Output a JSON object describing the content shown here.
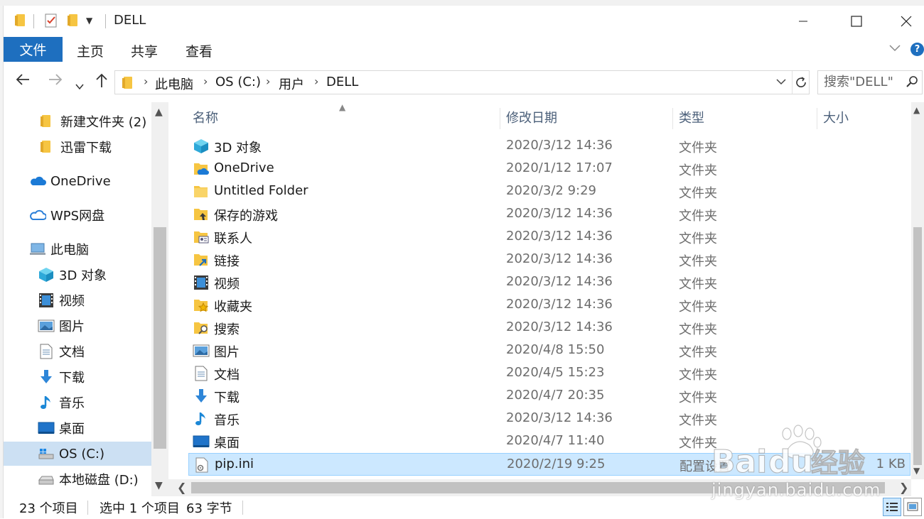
{
  "window": {
    "title": "DELL"
  },
  "ribbon": {
    "file_tab": "文件",
    "tabs": [
      "主页",
      "共享",
      "查看"
    ]
  },
  "address": {
    "crumbs": [
      "此电脑",
      "OS (C:)",
      "用户",
      "DELL"
    ]
  },
  "search": {
    "placeholder": "搜索\"DELL\""
  },
  "navpane": {
    "items": [
      {
        "label": "新建文件夹 (2)",
        "icon": "folder-icon"
      },
      {
        "label": "迅雷下载",
        "icon": "folder-icon"
      },
      {
        "label": "OneDrive",
        "icon": "cloud-icon"
      },
      {
        "label": "WPS网盘",
        "icon": "cloud-outline-icon"
      },
      {
        "label": "此电脑",
        "icon": "computer-icon"
      },
      {
        "label": "3D 对象",
        "icon": "cube-icon"
      },
      {
        "label": "视频",
        "icon": "video-icon"
      },
      {
        "label": "图片",
        "icon": "picture-icon"
      },
      {
        "label": "文档",
        "icon": "document-icon"
      },
      {
        "label": "下载",
        "icon": "download-icon"
      },
      {
        "label": "音乐",
        "icon": "music-icon"
      },
      {
        "label": "桌面",
        "icon": "desktop-icon"
      },
      {
        "label": "OS (C:)",
        "icon": "drive-icon",
        "selected": true
      },
      {
        "label": "本地磁盘 (D:)",
        "icon": "drive-icon"
      }
    ]
  },
  "columns": {
    "name": "名称",
    "date": "修改日期",
    "type": "类型",
    "size": "大小"
  },
  "files": [
    {
      "name": "3D 对象",
      "date": "2020/3/12 14:36",
      "type": "文件夹",
      "size": "",
      "icon": "cube-icon"
    },
    {
      "name": "OneDrive",
      "date": "2020/1/12 17:07",
      "type": "文件夹",
      "size": "",
      "icon": "onedrive-folder-icon"
    },
    {
      "name": "Untitled Folder",
      "date": "2020/3/2 9:29",
      "type": "文件夹",
      "size": "",
      "icon": "folder-icon"
    },
    {
      "name": "保存的游戏",
      "date": "2020/3/12 14:36",
      "type": "文件夹",
      "size": "",
      "icon": "saved-games-icon"
    },
    {
      "name": "联系人",
      "date": "2020/3/12 14:36",
      "type": "文件夹",
      "size": "",
      "icon": "contacts-icon"
    },
    {
      "name": "链接",
      "date": "2020/3/12 14:36",
      "type": "文件夹",
      "size": "",
      "icon": "links-icon"
    },
    {
      "name": "视频",
      "date": "2020/3/12 14:36",
      "type": "文件夹",
      "size": "",
      "icon": "video-icon"
    },
    {
      "name": "收藏夹",
      "date": "2020/3/12 14:36",
      "type": "文件夹",
      "size": "",
      "icon": "favorites-icon"
    },
    {
      "name": "搜索",
      "date": "2020/3/12 14:36",
      "type": "文件夹",
      "size": "",
      "icon": "searches-icon"
    },
    {
      "name": "图片",
      "date": "2020/4/8 15:50",
      "type": "文件夹",
      "size": "",
      "icon": "picture-icon"
    },
    {
      "name": "文档",
      "date": "2020/4/5 15:23",
      "type": "文件夹",
      "size": "",
      "icon": "document-icon"
    },
    {
      "name": "下载",
      "date": "2020/4/7 20:35",
      "type": "文件夹",
      "size": "",
      "icon": "download-icon"
    },
    {
      "name": "音乐",
      "date": "2020/3/12 14:36",
      "type": "文件夹",
      "size": "",
      "icon": "music-icon"
    },
    {
      "name": "桌面",
      "date": "2020/4/7 11:40",
      "type": "文件夹",
      "size": "",
      "icon": "desktop-icon"
    },
    {
      "name": "pip.ini",
      "date": "2020/2/19 9:25",
      "type": "配置设置",
      "size": "1 KB",
      "icon": "ini-file-icon",
      "selected": true
    }
  ],
  "status": {
    "count": "23 个项目",
    "selection": "选中 1 个项目",
    "bytes": "63 字节"
  },
  "watermark": {
    "brand": "Baidu经验",
    "url": "jingyan.baidu.com"
  },
  "colors": {
    "accent": "#1e6fbf",
    "selection": "#cce8ff",
    "folder": "#f6c542"
  }
}
